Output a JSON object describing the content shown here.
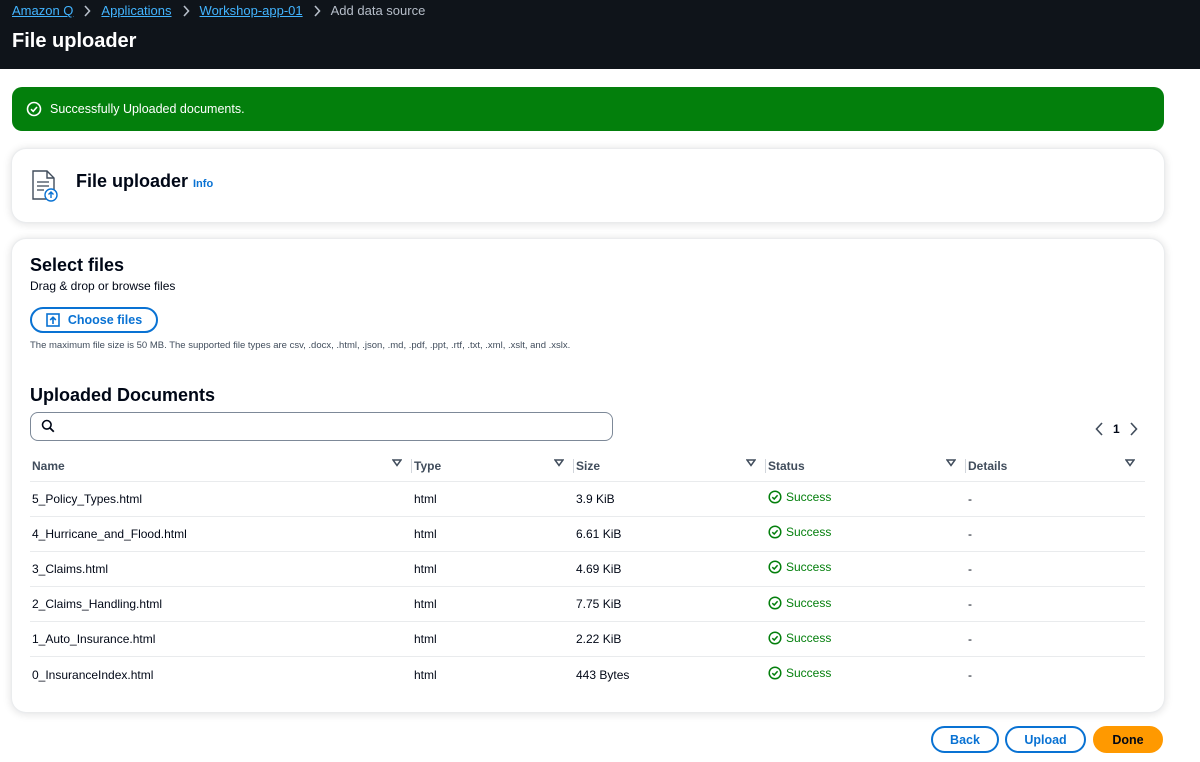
{
  "breadcrumb": {
    "items": [
      "Amazon Q",
      "Applications",
      "Workshop-app-01"
    ],
    "current": "Add data source"
  },
  "page": {
    "title": "File uploader"
  },
  "flash": {
    "message": "Successfully Uploaded documents.",
    "color": "#037f0c",
    "icon": "check-circle-icon"
  },
  "header_card": {
    "title": "File uploader",
    "info_label": "Info",
    "icon": "document-upload-icon"
  },
  "select_files": {
    "title": "Select files",
    "description": "Drag & drop or browse files",
    "button_label": "Choose files",
    "constraint": "The maximum file size is 50 MB. The supported file types are csv, .docx, .html, .json, .md, .pdf, .ppt, .rtf, .txt, .xml, .xslt, and .xslx."
  },
  "uploaded": {
    "title": "Uploaded Documents",
    "search_value": "",
    "search_placeholder": "",
    "page_number": "1",
    "columns": [
      "Name",
      "Type",
      "Size",
      "Status",
      "Details"
    ],
    "rows": [
      {
        "name": "5_Policy_Types.html",
        "type": "html",
        "size": "3.9 KiB",
        "status": "Success",
        "details": "-"
      },
      {
        "name": "4_Hurricane_and_Flood.html",
        "type": "html",
        "size": "6.61 KiB",
        "status": "Success",
        "details": "-"
      },
      {
        "name": "3_Claims.html",
        "type": "html",
        "size": "4.69 KiB",
        "status": "Success",
        "details": "-"
      },
      {
        "name": "2_Claims_Handling.html",
        "type": "html",
        "size": "7.75 KiB",
        "status": "Success",
        "details": "-"
      },
      {
        "name": "1_Auto_Insurance.html",
        "type": "html",
        "size": "2.22 KiB",
        "status": "Success",
        "details": "-"
      },
      {
        "name": "0_InsuranceIndex.html",
        "type": "html",
        "size": "443 Bytes",
        "status": "Success",
        "details": "-"
      }
    ]
  },
  "footer": {
    "back_label": "Back",
    "upload_label": "Upload",
    "done_label": "Done"
  },
  "colors": {
    "primary": "#ff9900",
    "link": "#0972d3",
    "success": "#037f0c",
    "header_bg": "#0f141a"
  }
}
